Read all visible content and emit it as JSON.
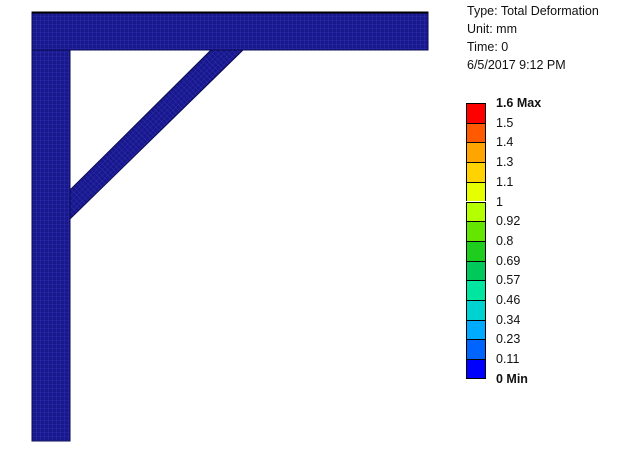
{
  "result_info": {
    "type_line": "Type: Total Deformation",
    "unit_line": "Unit: mm",
    "time_line": "Time: 0",
    "date_line": "6/5/2017 9:12 PM"
  },
  "legend": {
    "levels": [
      "1.6 Max",
      "1.5",
      "1.4",
      "1.3",
      "1.1",
      "1",
      "0.92",
      "0.8",
      "0.69",
      "0.57",
      "0.46",
      "0.34",
      "0.23",
      "0.11",
      "0 Min"
    ],
    "colors": [
      "#ff0000",
      "#ff5a00",
      "#ffa500",
      "#ffd200",
      "#e6ff00",
      "#b4ff00",
      "#64e600",
      "#1ecd1e",
      "#00c85a",
      "#00e6a0",
      "#00d2d2",
      "#00aaff",
      "#0064ff",
      "#0000ff"
    ]
  },
  "model": {
    "fill_color": "#18188c",
    "mesh_color": "#3c3cc8"
  }
}
